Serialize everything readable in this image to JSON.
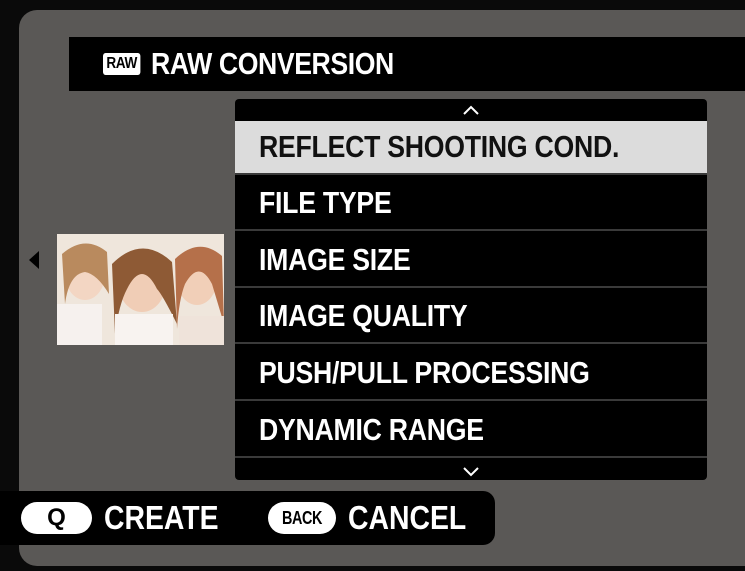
{
  "header": {
    "badge": "RAW",
    "title": "RAW CONVERSION"
  },
  "menu": {
    "items": [
      {
        "label": "REFLECT SHOOTING COND.",
        "selected": true
      },
      {
        "label": "FILE TYPE",
        "selected": false
      },
      {
        "label": "IMAGE SIZE",
        "selected": false
      },
      {
        "label": "IMAGE QUALITY",
        "selected": false
      },
      {
        "label": "PUSH/PULL PROCESSING",
        "selected": false
      },
      {
        "label": "DYNAMIC RANGE",
        "selected": false
      }
    ],
    "scroll_up_icon": "chevron-up-icon",
    "scroll_down_icon": "chevron-down-icon"
  },
  "preview": {
    "prev_icon": "triangle-left-icon"
  },
  "footer": {
    "q_key": "Q",
    "q_label": "CREATE",
    "back_key": "BACK",
    "back_label": "CANCEL"
  },
  "colors": {
    "screen_bg": "#5a5856",
    "bar_bg": "#000000",
    "selected_bg": "#dcdcdc",
    "text": "#ffffff"
  }
}
